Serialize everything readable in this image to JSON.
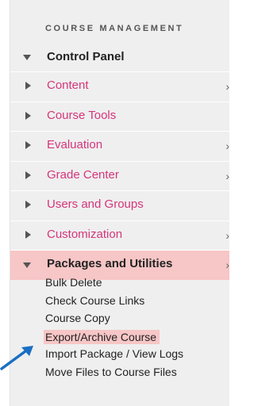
{
  "section_title": "COURSE MANAGEMENT",
  "control_panel": "Control Panel",
  "menu": [
    {
      "label": "Content",
      "has_submenu": true
    },
    {
      "label": "Course Tools",
      "has_submenu": false
    },
    {
      "label": "Evaluation",
      "has_submenu": true
    },
    {
      "label": "Grade Center",
      "has_submenu": true
    },
    {
      "label": "Users and Groups",
      "has_submenu": false
    },
    {
      "label": "Customization",
      "has_submenu": true
    },
    {
      "label": "Packages and Utilities",
      "has_submenu": true,
      "expanded": true
    }
  ],
  "submenu": [
    {
      "label": "Bulk Delete"
    },
    {
      "label": "Check Course Links"
    },
    {
      "label": "Course Copy"
    },
    {
      "label": "Export/Archive Course",
      "highlighted": true
    },
    {
      "label": "Import Package / View Logs"
    },
    {
      "label": "Move Files to Course Files"
    }
  ],
  "chevron": "›",
  "colors": {
    "link": "#d4357a",
    "highlight": "#f7c6c6",
    "arrow": "#1a6fc2"
  }
}
